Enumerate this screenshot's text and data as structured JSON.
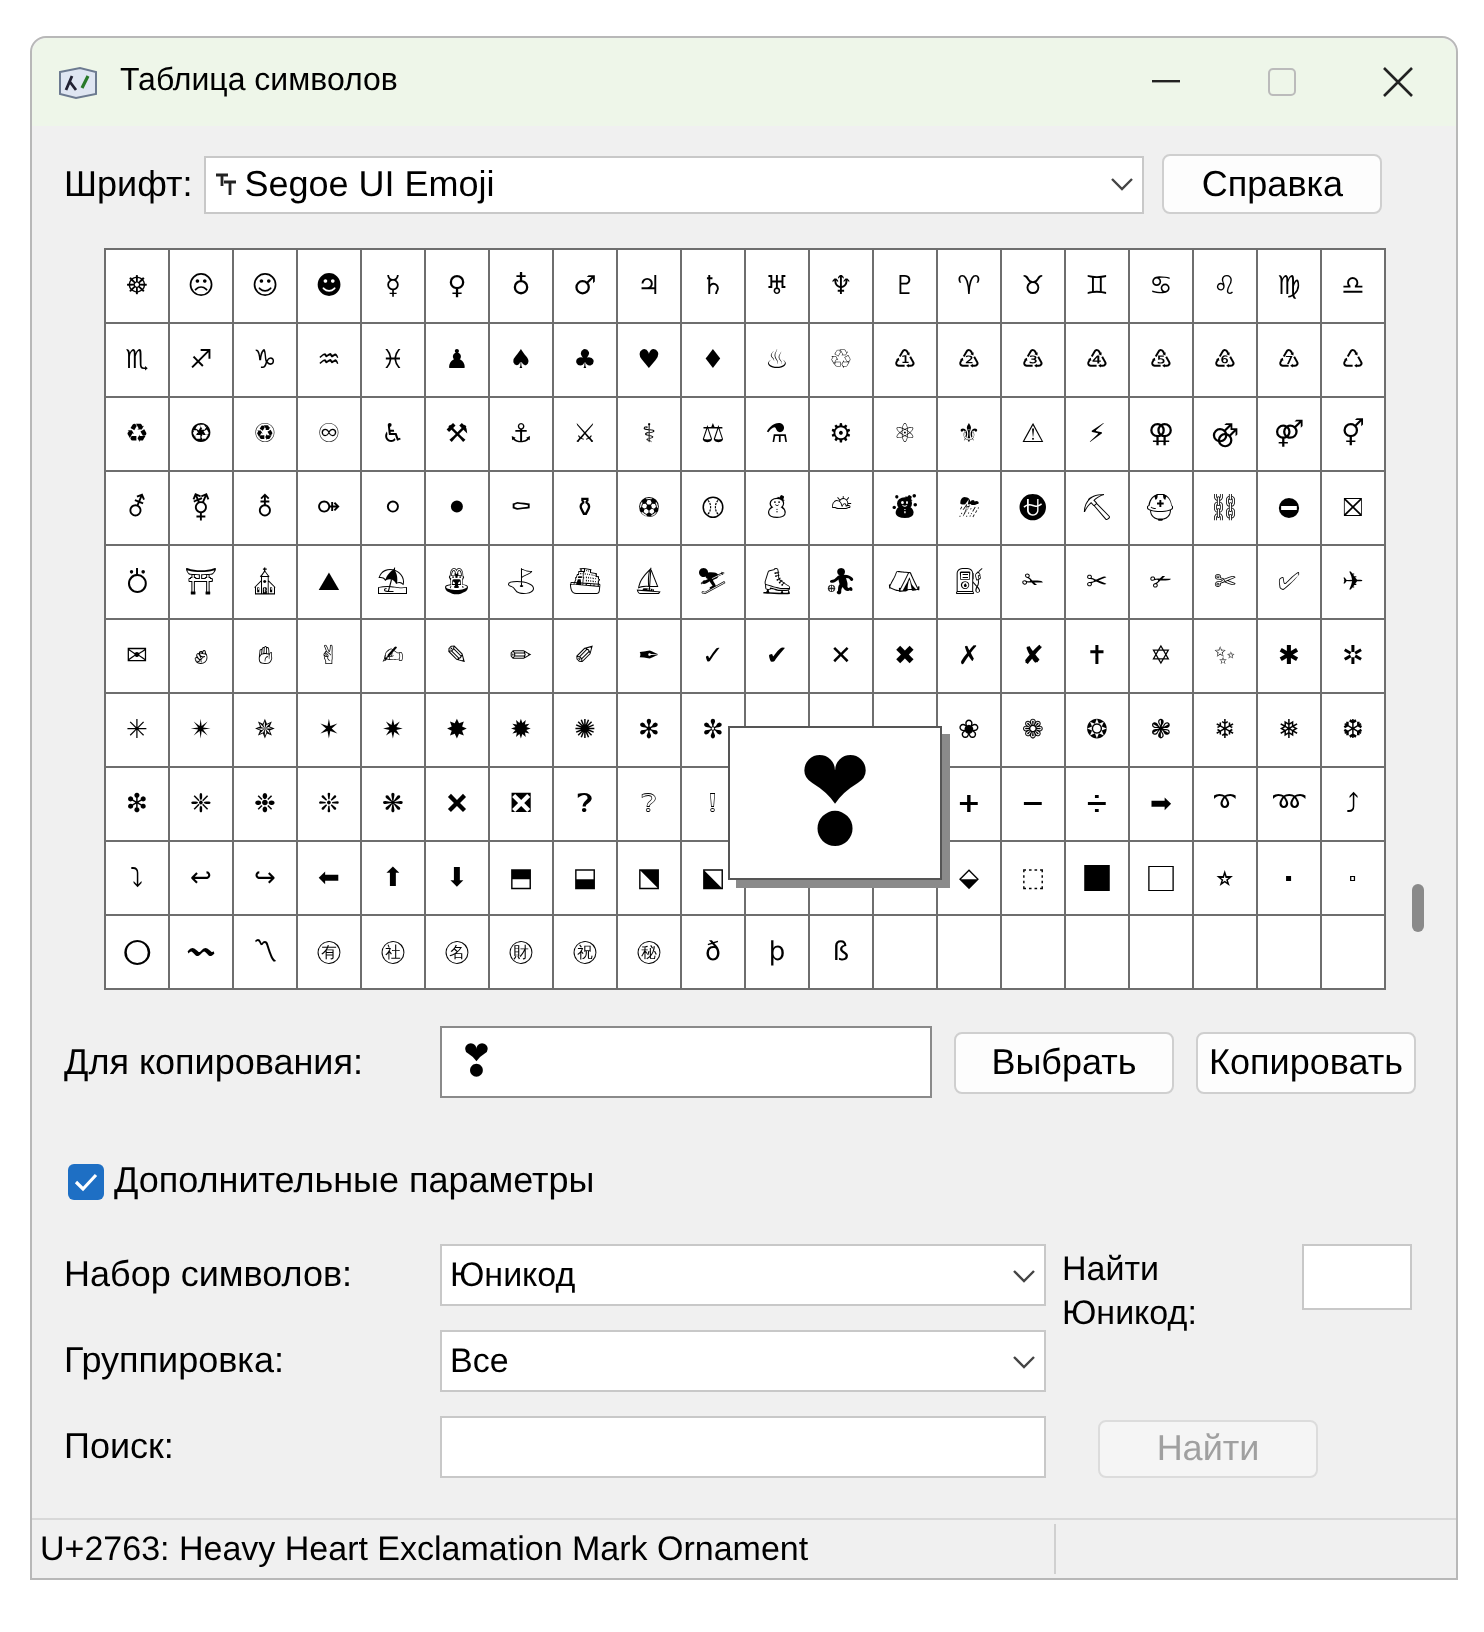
{
  "window": {
    "title": "Таблица символов"
  },
  "font": {
    "label": "Шрифт:",
    "value": "Segoe UI Emoji"
  },
  "help_button": "Справка",
  "grid": {
    "rows": [
      [
        "☸",
        "☹",
        "☺",
        "☻",
        "☿",
        "♀",
        "♁",
        "♂",
        "♃",
        "♄",
        "♅",
        "♆",
        "♇",
        "♈",
        "♉",
        "♊",
        "♋",
        "♌",
        "♍",
        "♎"
      ],
      [
        "♏",
        "♐",
        "♑",
        "♒",
        "♓",
        "♟",
        "♠",
        "♣",
        "♥",
        "♦",
        "♨",
        "♲",
        "♳",
        "♴",
        "♵",
        "♶",
        "♷",
        "♸",
        "♹",
        "♺"
      ],
      [
        "♻",
        "♼",
        "♽",
        "♾",
        "♿",
        "⚒",
        "⚓",
        "⚔",
        "⚕",
        "⚖",
        "⚗",
        "⚙",
        "⚛",
        "⚜",
        "⚠",
        "⚡",
        "⚢",
        "⚣",
        "⚤",
        "⚥"
      ],
      [
        "⚦",
        "⚧",
        "⚨",
        "⚩",
        "⚪",
        "⚫",
        "⚰",
        "⚱",
        "⚽",
        "⚾",
        "⛄",
        "⛅",
        "⛇",
        "⛈",
        "⛎",
        "⛏",
        "⛑",
        "⛓",
        "⛔",
        "⛝"
      ],
      [
        "⛣",
        "⛩",
        "⛪",
        "⛰",
        "⛱",
        "⛲",
        "⛳",
        "⛴",
        "⛵",
        "⛷",
        "⛸",
        "⛹",
        "⛺",
        "⛽",
        "✁",
        "✂",
        "✃",
        "✄",
        "✅",
        "✈"
      ],
      [
        "✉",
        "✊",
        "✋",
        "✌",
        "✍",
        "✎",
        "✏",
        "✐",
        "✒",
        "✓",
        "✔",
        "✕",
        "✖",
        "✗",
        "✘",
        "✝",
        "✡",
        "✨",
        "✱",
        "✲"
      ],
      [
        "✳",
        "✴",
        "✵",
        "✶",
        "✷",
        "✸",
        "✹",
        "✺",
        "✻",
        "✼",
        null,
        null,
        null,
        "❀",
        "❁",
        "❂",
        "❃",
        "❄",
        "❅",
        "❆"
      ],
      [
        "❇",
        "❈",
        "❉",
        "❊",
        "❋",
        "❌",
        "❎",
        "❓",
        "❔",
        "❕",
        null,
        null,
        null,
        "➕",
        "➖",
        "➗",
        "➡",
        "➰",
        "➿",
        "⤴"
      ],
      [
        "⤵",
        "↩",
        "↪",
        "⬅",
        "⬆",
        "⬇",
        "⬒",
        "⬓",
        "⬔",
        "⬕",
        null,
        null,
        null,
        "⬙",
        "⬚",
        "⬛",
        "⬜",
        "⭐",
        "⬝",
        "⬞"
      ],
      [
        "⭕",
        "〰",
        "〽",
        "㊒",
        "㊓",
        "㊔",
        "㊖",
        "㊗",
        "㊙",
        "ð",
        "þ",
        "ß",
        null,
        null,
        null,
        null,
        null,
        null,
        null,
        null
      ]
    ]
  },
  "magnified_symbol": "❣",
  "copy": {
    "label": "Для копирования:",
    "value": "❣",
    "select_button": "Выбрать",
    "copy_button": "Копировать"
  },
  "advanced": {
    "label": "Дополнительные параметры",
    "checked": true
  },
  "charset": {
    "label": "Набор символов:",
    "value": "Юникод"
  },
  "grouping": {
    "label": "Группировка:",
    "value": "Все"
  },
  "search": {
    "label": "Поиск:",
    "button": "Найти",
    "button_disabled": true
  },
  "unicode_find": {
    "label": "Найти Юникод:"
  },
  "status_bar": "U+2763: Heavy Heart Exclamation Mark Ornament"
}
